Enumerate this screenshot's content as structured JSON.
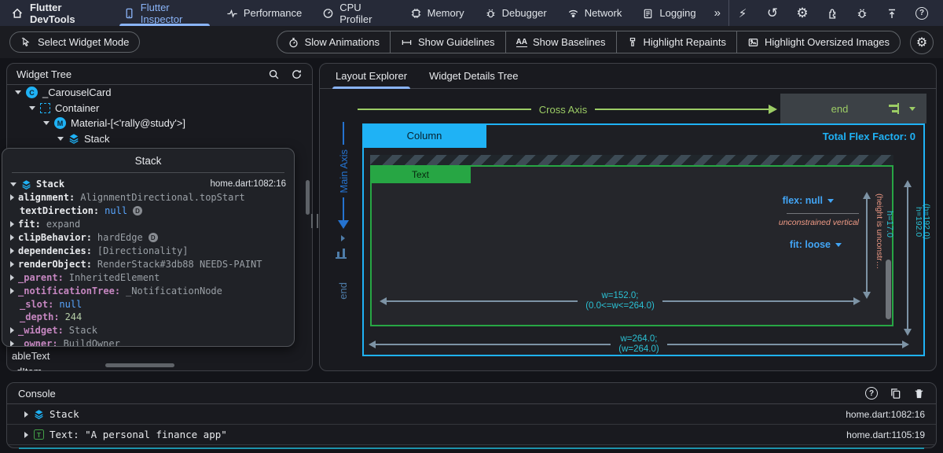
{
  "colors": {
    "accent": "#8ab4f8",
    "flutter_blue": "#1fb2f5",
    "widget_green": "#27a644",
    "lime_green": "#9ccc65",
    "teal": "#2bc1d4",
    "salmon": "#ef9a85",
    "private_purple": "#c586c0"
  },
  "topbar": {
    "brand": "Flutter DevTools",
    "tabs": [
      {
        "label": "Flutter Inspector",
        "icon": "inspector-phone-icon",
        "selected": true
      },
      {
        "label": "Performance",
        "icon": "performance-pulse-icon",
        "selected": false
      },
      {
        "label": "CPU Profiler",
        "icon": "cpu-gauge-icon",
        "selected": false
      },
      {
        "label": "Memory",
        "icon": "memory-chip-icon",
        "selected": false
      },
      {
        "label": "Debugger",
        "icon": "debugger-bug-icon",
        "selected": false
      },
      {
        "label": "Network",
        "icon": "network-signal-icon",
        "selected": false
      },
      {
        "label": "Logging",
        "icon": "logging-clipboard-icon",
        "selected": false
      }
    ],
    "overflow_glyph": "»",
    "actions": [
      {
        "name": "hot-reload",
        "glyph": "⚡"
      },
      {
        "name": "hot-restart",
        "glyph": "↺"
      },
      {
        "name": "settings",
        "glyph": "⚙"
      },
      {
        "name": "extensions",
        "glyph": ""
      },
      {
        "name": "report-bug",
        "glyph": ""
      },
      {
        "name": "export",
        "glyph": ""
      },
      {
        "name": "help",
        "glyph": "?"
      }
    ]
  },
  "toolbar": {
    "select_widget_mode": "Select Widget Mode",
    "settings_glyph": "⚙",
    "toggles": [
      {
        "label": "Slow Animations",
        "icon": "stopwatch-icon"
      },
      {
        "label": "Show Guidelines",
        "icon": "guidelines-icon"
      },
      {
        "label": "Show Baselines",
        "icon": "baselines-icon",
        "glyph": "AA"
      },
      {
        "label": "Highlight Repaints",
        "icon": "repaint-brush-icon"
      },
      {
        "label": "Highlight Oversized Images",
        "icon": "image-icon"
      }
    ]
  },
  "widget_tree": {
    "title": "Widget Tree",
    "items": [
      {
        "label": "_CarouselCard",
        "glyph": "C"
      },
      {
        "label": "Container"
      },
      {
        "label": "Material-[<'rally@study'>]",
        "glyph": "M"
      },
      {
        "label": "Stack"
      }
    ],
    "clipped_items": [
      "ableText",
      "dItem"
    ]
  },
  "popup": {
    "title": "Stack",
    "node": {
      "label": "Stack",
      "location": "home.dart:1082:16"
    },
    "properties": [
      {
        "name": "alignment:",
        "value": "AlignmentDirectional.topStart"
      },
      {
        "name": "textDirection:",
        "value": "null",
        "badge": "D"
      },
      {
        "name": "fit:",
        "value": "expand"
      },
      {
        "name": "clipBehavior:",
        "value": "hardEdge",
        "badge": "D"
      },
      {
        "name": "dependencies:",
        "value": "[Directionality]"
      },
      {
        "name": "renderObject:",
        "value": "RenderStack#3db88 NEEDS-PAINT"
      },
      {
        "name": "_parent:",
        "value": "InheritedElement"
      },
      {
        "name": "_notificationTree:",
        "value": "_NotificationNode"
      },
      {
        "name": "_slot:",
        "value": "null"
      },
      {
        "name": "_depth:",
        "value": "244"
      },
      {
        "name": "_widget:",
        "value": "Stack"
      },
      {
        "name": "_owner:",
        "value": "BuildOwner"
      }
    ]
  },
  "explorer": {
    "tabs": [
      {
        "label": "Layout Explorer",
        "selected": true
      },
      {
        "label": "Widget Details Tree",
        "selected": false
      }
    ],
    "cross_axis": {
      "label": "Cross Axis",
      "alignment": "end"
    },
    "main_axis": {
      "label": "Main Axis",
      "alignment": "end"
    },
    "column": {
      "name": "Column",
      "total_flex": "Total Flex Factor: 0"
    },
    "text_child": {
      "name": "Text",
      "flex": "flex: null",
      "constraint_note": "unconstrained vertical",
      "fit": "fit: loose",
      "height": "h=17.0",
      "height_note": "(height is unconstr…",
      "width_line1": "w=152.0;",
      "width_line2": "(0.0<=w<=264.0)"
    },
    "column_width_line1": "w=264.0;",
    "column_width_line2": "(w=264.0)",
    "column_height_line1": "h=192.0",
    "column_height_line2": "(h=192.0)"
  },
  "console": {
    "title": "Console",
    "help_glyph": "?",
    "rows": [
      {
        "label": "Stack",
        "location": "home.dart:1082:16",
        "icon": "stack-layers-icon"
      },
      {
        "label": "Text: \"A personal finance app\"",
        "location": "home.dart:1105:19",
        "icon": "text-widget-icon",
        "glyph": "T"
      }
    ]
  }
}
